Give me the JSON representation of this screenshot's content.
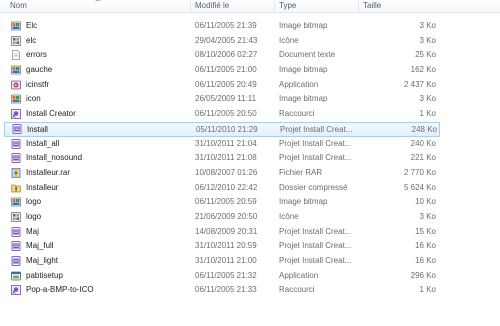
{
  "columns": {
    "name": "Nom",
    "modified": "Modifié le",
    "type": "Type",
    "size": "Taille"
  },
  "files": [
    {
      "name": "Elc",
      "modified": "06/11/2005 21:39",
      "type": "Image bitmap",
      "size": "3 Ko",
      "icon": "bitmap-icon"
    },
    {
      "name": "elc",
      "modified": "29/04/2005 21:43",
      "type": "Icône",
      "size": "3 Ko",
      "icon": "icon-file-icon"
    },
    {
      "name": "errors",
      "modified": "08/10/2006 02:27",
      "type": "Document texte",
      "size": "25 Ko",
      "icon": "text-document-icon"
    },
    {
      "name": "gauche",
      "modified": "06/11/2005 21:00",
      "type": "Image bitmap",
      "size": "162 Ko",
      "icon": "bitmap-icon"
    },
    {
      "name": "icinstfr",
      "modified": "06/11/2005 20:49",
      "type": "Application",
      "size": "2 437 Ko",
      "icon": "installer-app-icon"
    },
    {
      "name": "icon",
      "modified": "26/05/2009 11:11",
      "type": "Image bitmap",
      "size": "3 Ko",
      "icon": "bitmap-icon"
    },
    {
      "name": "Install Creator",
      "modified": "06/11/2005 20:50",
      "type": "Raccourci",
      "size": "1 Ko",
      "icon": "shortcut-icon"
    },
    {
      "name": "Install",
      "modified": "05/11/2010 21:29",
      "type": "Projet Install Creat...",
      "size": "248 Ko",
      "icon": "project-icon",
      "selected": true
    },
    {
      "name": "Install_all",
      "modified": "31/10/2011 21:04",
      "type": "Projet Install Creat...",
      "size": "240 Ko",
      "icon": "project-icon"
    },
    {
      "name": "Install_nosound",
      "modified": "31/10/2011 21:08",
      "type": "Projet Install Creat...",
      "size": "221 Ko",
      "icon": "project-icon"
    },
    {
      "name": "Installeur.rar",
      "modified": "10/08/2007 01:26",
      "type": "Fichier RAR",
      "size": "2 770 Ko",
      "icon": "rar-archive-icon"
    },
    {
      "name": "Installeur",
      "modified": "06/12/2010 22:42",
      "type": "Dossier compressé",
      "size": "5 624 Ko",
      "icon": "zip-folder-icon"
    },
    {
      "name": "logo",
      "modified": "06/11/2005 20:59",
      "type": "Image bitmap",
      "size": "10 Ko",
      "icon": "bitmap-icon"
    },
    {
      "name": "logo",
      "modified": "21/06/2009 20:50",
      "type": "Icône",
      "size": "3 Ko",
      "icon": "icon-file-icon"
    },
    {
      "name": "Maj",
      "modified": "14/08/2009 20:31",
      "type": "Projet Install Creat...",
      "size": "15 Ko",
      "icon": "project-icon"
    },
    {
      "name": "Maj_full",
      "modified": "31/10/2011 20:59",
      "type": "Projet Install Creat...",
      "size": "16 Ko",
      "icon": "project-icon"
    },
    {
      "name": "Maj_light",
      "modified": "31/10/2011 21:00",
      "type": "Projet Install Creat...",
      "size": "16 Ko",
      "icon": "project-icon"
    },
    {
      "name": "pabtisetup",
      "modified": "06/11/2005 21:32",
      "type": "Application",
      "size": "296 Ko",
      "icon": "setup-app-icon"
    },
    {
      "name": "Pop-a-BMP-to-ICO",
      "modified": "06/11/2005 21:33",
      "type": "Raccourci",
      "size": "1 Ko",
      "icon": "shortcut-icon"
    }
  ],
  "colors": {
    "selection_border": "#a9cdf3",
    "selection_fill": "#e3effc",
    "header_text": "#4c607a",
    "secondary_text": "#6d6d6d"
  }
}
